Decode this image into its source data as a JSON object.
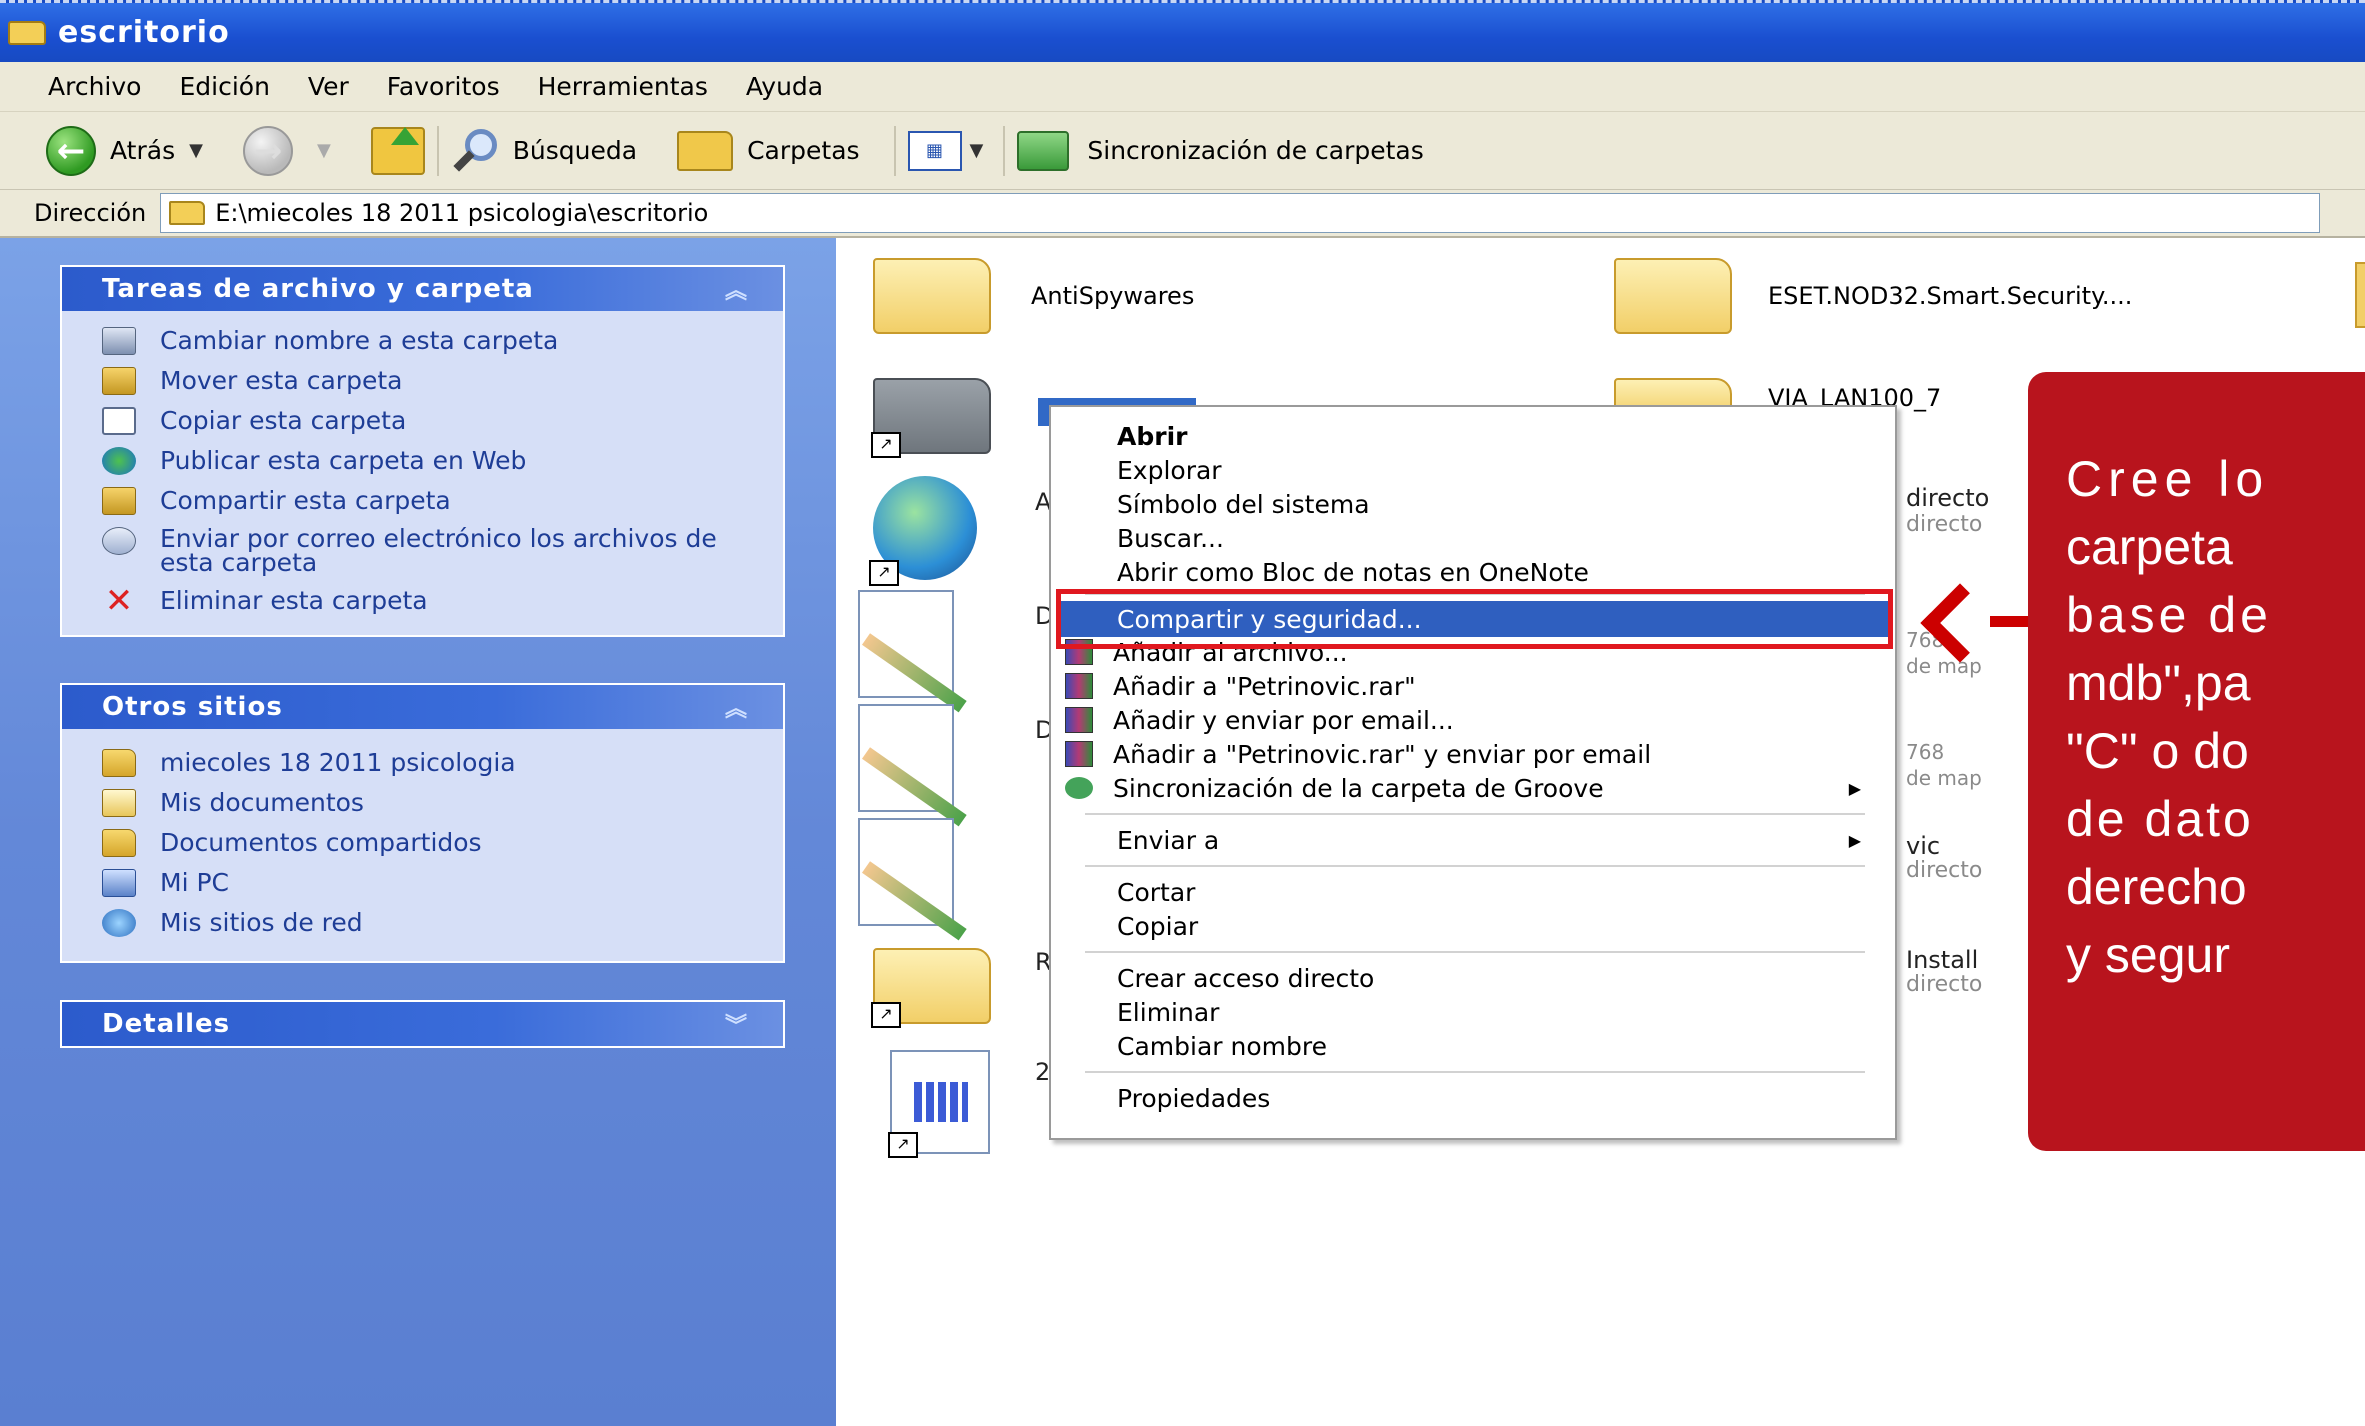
{
  "window": {
    "title": "escritorio"
  },
  "menubar": [
    "Archivo",
    "Edición",
    "Ver",
    "Favoritos",
    "Herramientas",
    "Ayuda"
  ],
  "toolbar": {
    "back_label": "Atrás",
    "search_label": "Búsqueda",
    "folders_label": "Carpetas",
    "sync_label": "Sincronización de carpetas"
  },
  "address": {
    "label": "Dirección",
    "path": "E:\\miecoles 18 2011 psicologia\\escritorio"
  },
  "left_panel": {
    "tasks": {
      "title": "Tareas de archivo y carpeta",
      "items": [
        "Cambiar nombre a esta carpeta",
        "Mover esta carpeta",
        "Copiar esta carpeta",
        "Publicar esta carpeta en Web",
        "Compartir esta carpeta",
        "Enviar por correo electrónico los archivos de esta carpeta",
        "Eliminar esta carpeta"
      ]
    },
    "other_places": {
      "title": "Otros sitios",
      "items": [
        "miecoles 18 2011 psicologia",
        "Mis documentos",
        "Documentos compartidos",
        "Mi PC",
        "Mis sitios de red"
      ]
    },
    "details": {
      "title": "Detalles"
    }
  },
  "files": {
    "antispyware": "AntiSpywares",
    "eset": "ESET.NOD32.Smart.Security....",
    "via_lan": "VIA_LAN100_7",
    "right_partials": {
      "r1a": "directo",
      "r1b": "directo",
      "r2a": "768",
      "r2b": "de map",
      "r3a": "768",
      "r3b": "de map",
      "r4a": "vic",
      "r4b": "directo",
      "r5a": "Install",
      "r5b": "directo"
    },
    "left_partials": {
      "l1": "A",
      "l2": "D",
      "l3": "D",
      "l4": "R",
      "l5": "2"
    }
  },
  "context_menu": {
    "open": "Abrir",
    "explore": "Explorar",
    "cmd": "Símbolo del sistema",
    "search": "Buscar...",
    "onenote": "Abrir como Bloc de notas en OneNote",
    "share": "Compartir y seguridad...",
    "add_archive": "Añadir al archivo...",
    "add_rar": "Añadir a \"Petrinovic.rar\"",
    "add_email": "Añadir y enviar por email...",
    "add_rar_email": "Añadir a \"Petrinovic.rar\" y enviar por email",
    "groove": "Sincronización de la carpeta de Groove",
    "send_to": "Enviar a",
    "cut": "Cortar",
    "copy": "Copiar",
    "shortcut": "Crear acceso directo",
    "delete": "Eliminar",
    "rename": "Cambiar nombre",
    "properties": "Propiedades"
  },
  "callout": {
    "lines": [
      "Cree lo",
      "carpeta",
      "base de",
      "mdb\",pa",
      "\"C\" o do",
      "de dato",
      "derecho",
      "y segur"
    ],
    "color": "#b8141d"
  }
}
